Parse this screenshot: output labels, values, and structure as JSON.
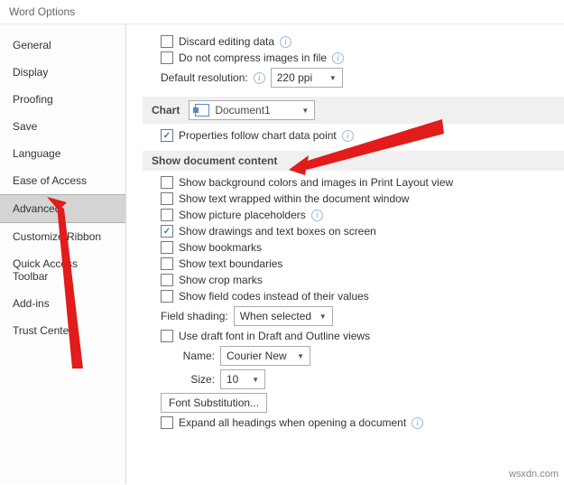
{
  "title": "Word Options",
  "sidebar": {
    "items": [
      {
        "label": "General"
      },
      {
        "label": "Display"
      },
      {
        "label": "Proofing"
      },
      {
        "label": "Save"
      },
      {
        "label": "Language"
      },
      {
        "label": "Ease of Access"
      },
      {
        "label": "Advanced"
      },
      {
        "label": "Customize Ribbon"
      },
      {
        "label": "Quick Access Toolbar"
      },
      {
        "label": "Add-ins"
      },
      {
        "label": "Trust Center"
      }
    ],
    "selected": "Advanced"
  },
  "top": {
    "discard": "Discard editing data",
    "compress": "Do not compress images in file",
    "defres_label": "Default resolution:",
    "defres_value": "220 ppi"
  },
  "chart": {
    "section": "Chart",
    "doc": "Document1",
    "prop": "Properties follow chart data point"
  },
  "sdc": {
    "section": "Show document content",
    "bg": "Show background colors and images in Print Layout view",
    "wrap": "Show text wrapped within the document window",
    "pic": "Show picture placeholders",
    "draw": "Show drawings and text boxes on screen",
    "bm": "Show bookmarks",
    "tb": "Show text boundaries",
    "crop": "Show crop marks",
    "fc": "Show field codes instead of their values",
    "fs_label": "Field shading:",
    "fs_value": "When selected",
    "draft": "Use draft font in Draft and Outline views",
    "name_label": "Name:",
    "name_value": "Courier New",
    "size_label": "Size:",
    "size_value": "10",
    "fontsub": "Font Substitution...",
    "expand": "Expand all headings when opening a document"
  },
  "watermark": "wsxdn.com"
}
